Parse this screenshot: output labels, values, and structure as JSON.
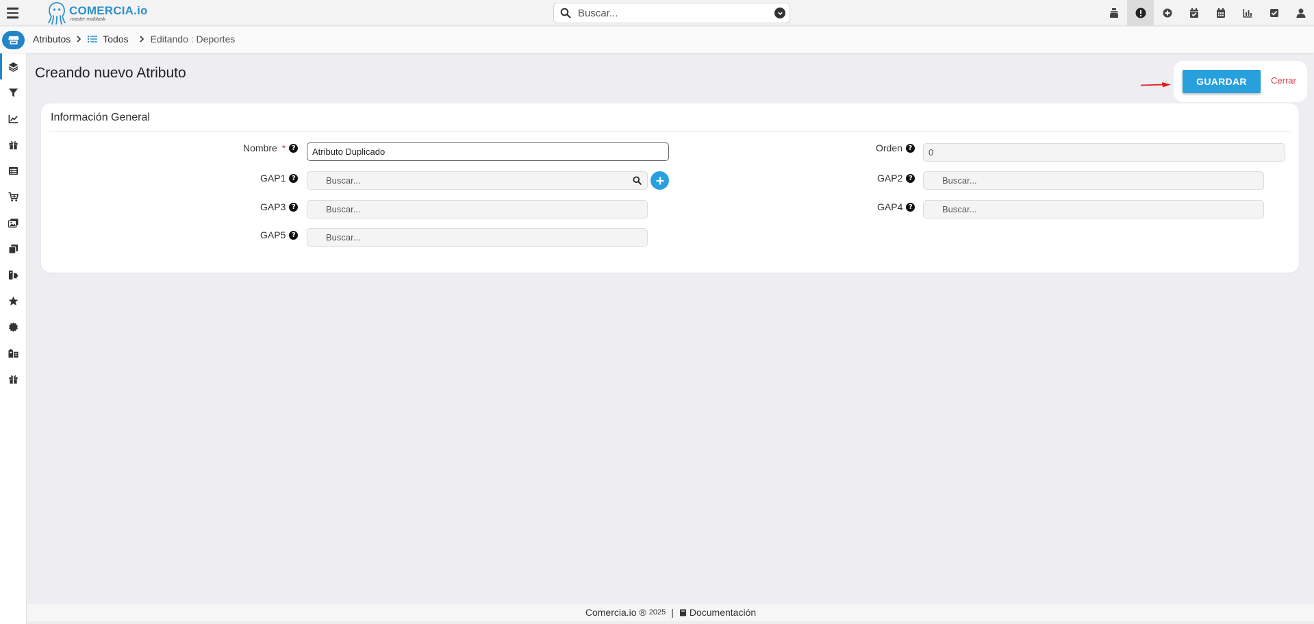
{
  "header": {
    "logo_name": "COMERCIA.io",
    "logo_tagline": "master multitask",
    "search_placeholder": "Buscar..."
  },
  "top_icons": [
    "cash-register-icon",
    "alert-icon",
    "plus-circle-icon",
    "calendar-check-icon",
    "calendar-icon",
    "chart-bar-icon",
    "check-square-icon",
    "user-icon"
  ],
  "breadcrumb": {
    "root": "Atributos",
    "list": "Todos",
    "current": "Editando : Deportes"
  },
  "sidebar_icons": [
    "layers-icon",
    "filter-icon",
    "chart-line-icon",
    "gift-icon",
    "list-icon",
    "cart-plus-icon",
    "images-icon",
    "copy-icon",
    "tags-icon",
    "star-icon",
    "certificate-icon",
    "warehouse-icon",
    "gift-box-icon"
  ],
  "page": {
    "title": "Creando nuevo Atributo",
    "save_label": "GUARDAR",
    "close_label": "Cerrar"
  },
  "form": {
    "section_title": "Información General",
    "nombre_label": "Nombre",
    "required_mark": "*",
    "nombre_value": "Atributo Duplicado",
    "orden_label": "Orden",
    "orden_value": "0",
    "gap1_label": "GAP1",
    "gap1_placeholder": "Buscar...",
    "gap2_label": "GAP2",
    "gap2_placeholder": "Buscar...",
    "gap3_label": "GAP3",
    "gap3_placeholder": "Buscar...",
    "gap4_label": "GAP4",
    "gap4_placeholder": "Buscar...",
    "gap5_label": "GAP5",
    "gap5_placeholder": "Buscar..."
  },
  "footer": {
    "brand": "Comercia.io ®",
    "year": "2025",
    "separator": "|",
    "docs": "Documentación"
  },
  "colors": {
    "primary": "#29a0de",
    "brand_blue": "#2285c7",
    "danger": "#e2384d",
    "background": "#eeeef2"
  }
}
